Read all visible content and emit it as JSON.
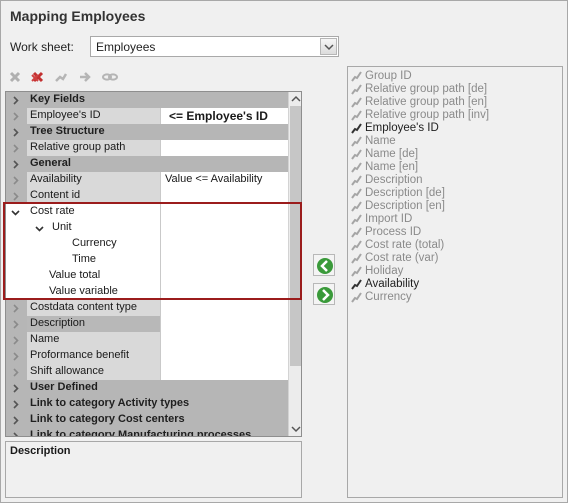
{
  "dialog": {
    "title": "Mapping Employees",
    "worksheet_label": "Work sheet:",
    "worksheet_value": "Employees"
  },
  "toolbar": {
    "buttons": [
      "delete-icon",
      "delete-all-icon",
      "link-icon",
      "move-icon",
      "chain-icon"
    ]
  },
  "grid": {
    "rows": [
      {
        "type": "cat",
        "label": "Key Fields"
      },
      {
        "type": "row",
        "label": "Employee's ID",
        "value": "<= Employee's ID",
        "icon": "pencil",
        "bold_value": true
      },
      {
        "type": "cat",
        "label": "Tree Structure"
      },
      {
        "type": "row",
        "label": "Relative group path",
        "value": ""
      },
      {
        "type": "cat",
        "label": "General"
      },
      {
        "type": "row",
        "label": "Availability",
        "value": "Value <= Availability",
        "icon": "star"
      },
      {
        "type": "row",
        "label": "Content id",
        "value": ""
      },
      {
        "type": "row",
        "label": "Cost rate",
        "value": "",
        "expanded": true
      },
      {
        "type": "row",
        "label": "Unit",
        "value": "",
        "icon": "star",
        "expanded": true,
        "indent": 1
      },
      {
        "type": "row",
        "label": "Currency",
        "value": "",
        "icon": "star",
        "indent": 2
      },
      {
        "type": "row",
        "label": "Time",
        "value": "",
        "indent": 2
      },
      {
        "type": "row",
        "label": "Value total",
        "value": "",
        "icon": "star",
        "indent": 1
      },
      {
        "type": "row",
        "label": "Value variable",
        "value": "",
        "indent": 1
      },
      {
        "type": "row",
        "label": "Costdata content type",
        "value": ""
      },
      {
        "type": "row",
        "label": "Description",
        "value": "",
        "dark": true
      },
      {
        "type": "row",
        "label": "Name",
        "value": ""
      },
      {
        "type": "row",
        "label": "Proformance benefit",
        "value": ""
      },
      {
        "type": "row",
        "label": "Shift allowance",
        "value": ""
      },
      {
        "type": "cat",
        "label": "User Defined"
      },
      {
        "type": "cat",
        "label": "Link to category Activity types"
      },
      {
        "type": "cat",
        "label": "Link to category Cost centers"
      },
      {
        "type": "cat",
        "label": "Link to category Manufacturing processes"
      }
    ]
  },
  "description": {
    "label": "Description"
  },
  "fields": [
    {
      "label": "Group ID",
      "active": false
    },
    {
      "label": "Relative group path [de]",
      "active": false
    },
    {
      "label": "Relative group path [en]",
      "active": false
    },
    {
      "label": "Relative group path [inv]",
      "active": false
    },
    {
      "label": "Employee's ID",
      "active": true
    },
    {
      "label": "Name",
      "active": false
    },
    {
      "label": "Name [de]",
      "active": false
    },
    {
      "label": "Name [en]",
      "active": false
    },
    {
      "label": "Description",
      "active": false
    },
    {
      "label": "Description [de]",
      "active": false
    },
    {
      "label": "Description [en]",
      "active": false
    },
    {
      "label": "Import ID",
      "active": false
    },
    {
      "label": "Process ID",
      "active": false
    },
    {
      "label": "Cost rate (total)",
      "active": false
    },
    {
      "label": "Cost rate (var)",
      "active": false
    },
    {
      "label": "Holiday",
      "active": false
    },
    {
      "label": "Availability",
      "active": true
    },
    {
      "label": "Currency",
      "active": false
    }
  ],
  "colors": {
    "highlight_box": "#9b1c1c",
    "arrow_green": "#3a9a3a",
    "star": "#e8c000"
  }
}
